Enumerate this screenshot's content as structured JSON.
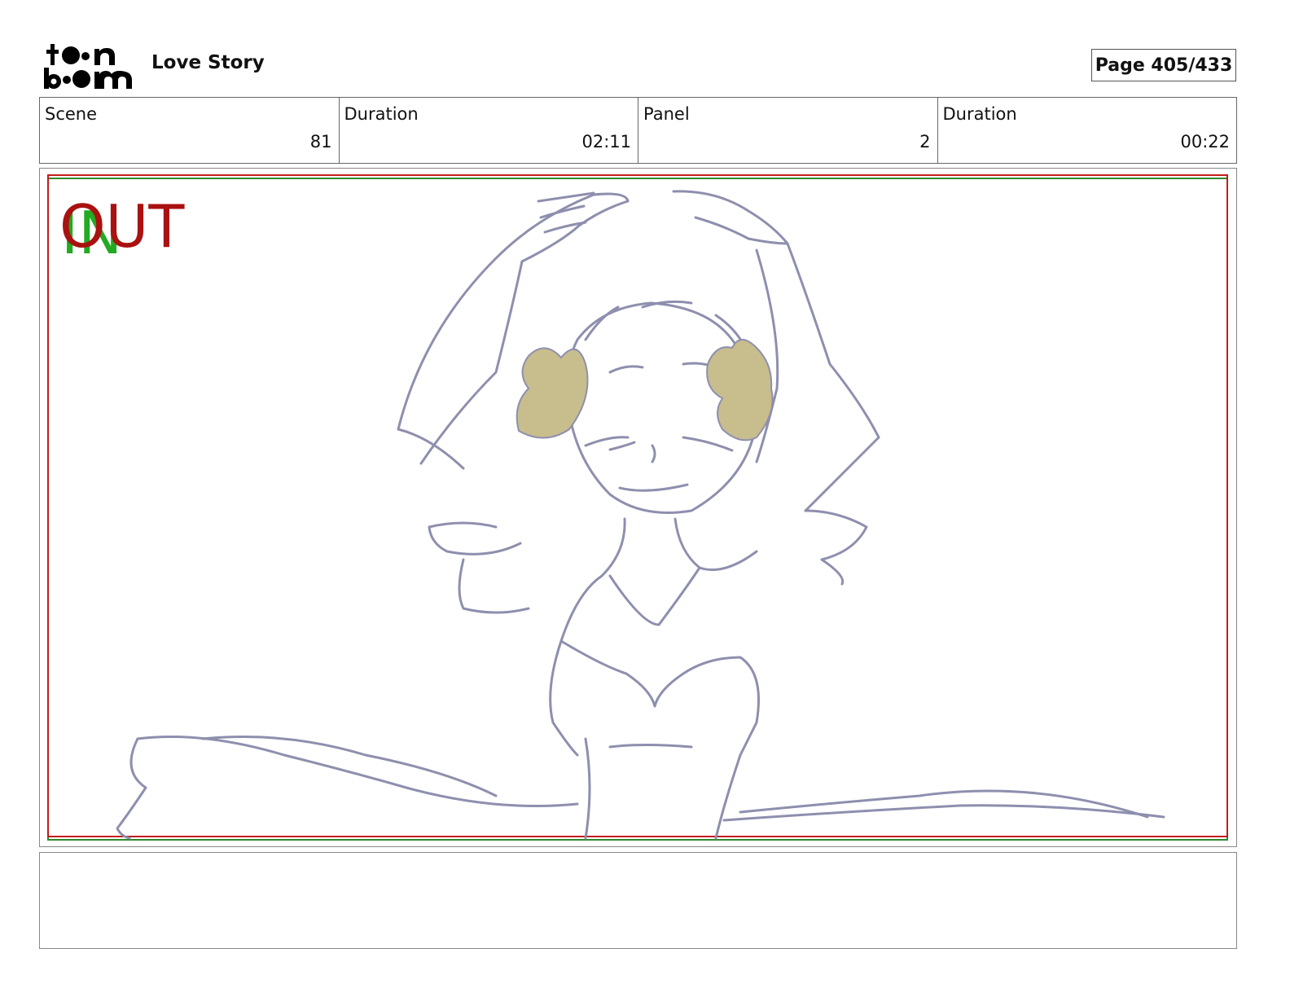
{
  "header": {
    "logo_line1": "toon",
    "logo_line2": "boom",
    "project_title": "Love Story",
    "page_label": "Page 405/433"
  },
  "info": [
    {
      "label": "Scene",
      "value": "81"
    },
    {
      "label": "Duration",
      "value": "02:11"
    },
    {
      "label": "Panel",
      "value": "2"
    },
    {
      "label": "Duration",
      "value": "00:22"
    }
  ],
  "panel": {
    "in_label": "IN",
    "out_label": "OUT",
    "in_color": "#22aa22",
    "out_color": "#aa1111",
    "safe_frame_red": "#c41c1c",
    "safe_frame_green": "#2e8b2e",
    "line_color": "#8e8fae",
    "accent_color": "#c8bd8c"
  },
  "notes": {
    "text": ""
  }
}
